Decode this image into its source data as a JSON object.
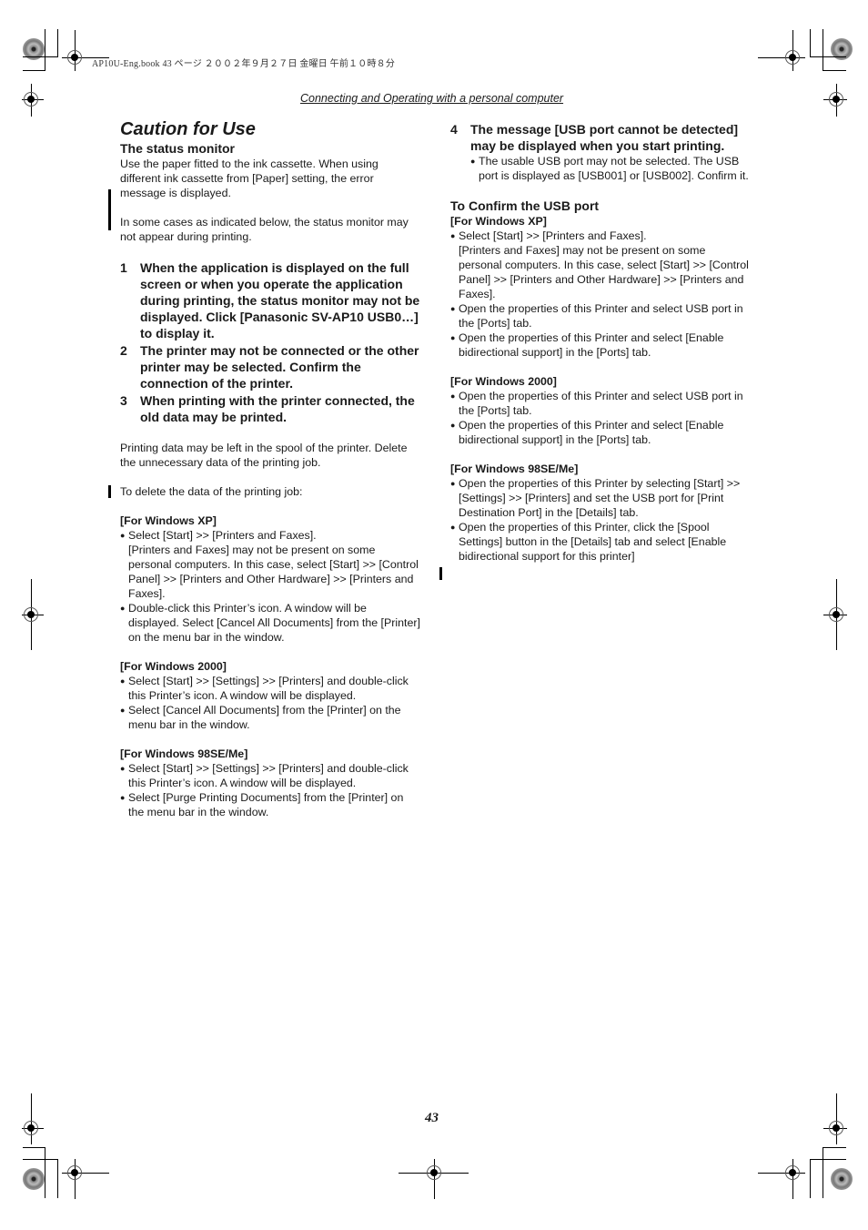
{
  "print_meta": {
    "text": "AP10U-Eng.book  43 ページ  ２００２年９月２７日  金曜日  午前１０時８分"
  },
  "section_header": "Connecting and Operating with a personal computer",
  "page_number": "43",
  "left_column": {
    "title": "Caution for Use",
    "status_monitor": {
      "heading": "The status monitor",
      "para1": "Use the paper fitted to the ink cassette. When using different ink cassette from [Paper] setting, the error message is displayed.",
      "para2": "In some cases as indicated below, the status monitor may not appear during printing."
    },
    "numbered": [
      {
        "num": "1",
        "text": "When the application is displayed on the full screen or when you operate the application during printing, the status monitor may not be displayed. Click [Panasonic SV-AP10 USB0…] to display it."
      },
      {
        "num": "2",
        "text": "The printer may not be connected or the other printer may be selected. Confirm the connection of the printer."
      },
      {
        "num": "3",
        "text": "When printing with the printer connected, the old data may be printed."
      }
    ],
    "spool_para": "Printing data may be left in the spool of the printer. Delete the unnecessary data of the printing job.",
    "delete_intro": "To delete the data of the printing job:",
    "groups": [
      {
        "os": "[For Windows XP]",
        "bullets": [
          "Select [Start] >> [Printers and Faxes].\n[Printers and Faxes] may not be present on some personal computers. In this case, select [Start] >> [Control Panel] >> [Printers and Other Hardware] >> [Printers and Faxes].",
          "Double-click this Printer’s icon. A window will be displayed. Select [Cancel All Documents] from the [Printer] on the menu bar in the window."
        ]
      },
      {
        "os": "[For Windows 2000]",
        "bullets": [
          "Select [Start] >> [Settings] >> [Printers] and double-click this Printer’s icon. A window will be displayed.",
          "Select [Cancel All Documents] from the [Printer] on the menu bar in the window."
        ]
      },
      {
        "os": "[For Windows 98SE/Me]",
        "bullets": [
          "Select [Start] >> [Settings] >> [Printers] and double-click this Printer’s icon. A window will be displayed.",
          "Select [Purge Printing Documents] from the [Printer] on the menu bar in the window."
        ]
      }
    ]
  },
  "right_column": {
    "item4": {
      "num": "4",
      "text": "The message [USB port cannot be detected] may be displayed when you start printing.",
      "bullet": "The usable USB port may not be selected. The USB port is displayed as [USB001] or [USB002]. Confirm it."
    },
    "confirm_heading": "To Confirm the USB port",
    "groups": [
      {
        "os": "[For Windows XP]",
        "bullets": [
          "Select [Start] >> [Printers and Faxes].\n[Printers and Faxes] may not be present on some personal computers. In this case, select [Start] >> [Control Panel] >> [Printers and Other Hardware] >> [Printers and Faxes].",
          "Open the properties of this Printer and select USB port in the [Ports] tab.",
          "Open the properties of this Printer and select [Enable bidirectional support] in the [Ports] tab."
        ]
      },
      {
        "os": "[For Windows 2000]",
        "bullets": [
          "Open the properties of this Printer and select USB port in the [Ports] tab.",
          "Open the properties of this Printer and select [Enable bidirectional support] in the [Ports] tab."
        ]
      },
      {
        "os": "[For Windows 98SE/Me]",
        "bullets": [
          "Open the properties of this Printer by selecting [Start] >> [Settings] >> [Printers] and set the USB port for [Print Destination Port] in the [Details] tab.",
          "Open the properties of this Printer, click the [Spool Settings] button in the [Details] tab and select [Enable bidirectional support for this printer]"
        ]
      }
    ]
  },
  "bullet_glyph": "●"
}
